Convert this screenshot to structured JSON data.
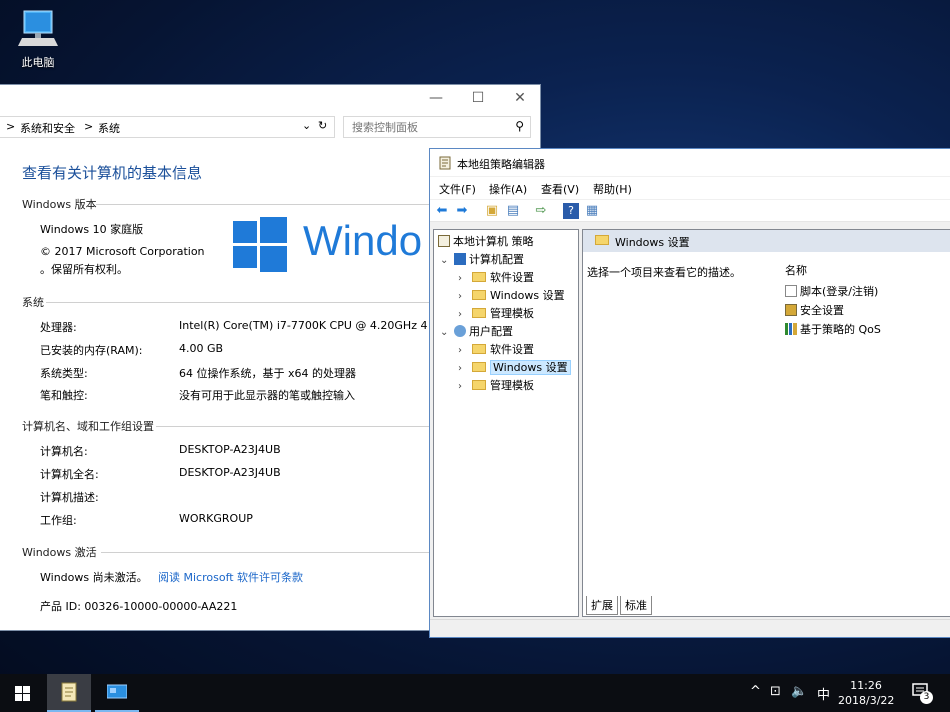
{
  "desktop": {
    "icon_label": "此电脑"
  },
  "system_window": {
    "breadcrumb": [
      ">",
      "系统和安全",
      ">",
      "系统"
    ],
    "search_placeholder": "搜索控制面板",
    "page_title": "查看有关计算机的基本信息",
    "edition_section": {
      "heading": "Windows 版本",
      "edition": "Windows 10 家庭版",
      "copyright_line1": "© 2017 Microsoft Corporation",
      "copyright_line2": "。保留所有权利。",
      "logo_text": "Windo"
    },
    "system_section": {
      "heading": "系统",
      "rows": [
        {
          "key": "处理器:",
          "value": "Intel(R) Core(TM) i7-7700K CPU @ 4.20GHz   4"
        },
        {
          "key": "已安装的内存(RAM):",
          "value": "4.00 GB"
        },
        {
          "key": "系统类型:",
          "value": "64 位操作系统，基于 x64 的处理器"
        },
        {
          "key": "笔和触控:",
          "value": "没有可用于此显示器的笔或触控输入"
        }
      ]
    },
    "computer_section": {
      "heading": "计算机名、域和工作组设置",
      "rows": [
        {
          "key": "计算机名:",
          "value": "DESKTOP-A23J4UB"
        },
        {
          "key": "计算机全名:",
          "value": "DESKTOP-A23J4UB"
        },
        {
          "key": "计算机描述:",
          "value": ""
        },
        {
          "key": "工作组:",
          "value": "WORKGROUP"
        }
      ]
    },
    "activation_section": {
      "heading": "Windows 激活",
      "status": "Windows 尚未激活。",
      "link": "阅读 Microsoft 软件许可条款",
      "product_id": "产品 ID: 00326-10000-00000-AA221"
    },
    "caption": {
      "minimize": "—",
      "maximize": "☐",
      "close": "✕"
    }
  },
  "gpedit_window": {
    "title": "本地组策略编辑器",
    "menu": [
      "文件(F)",
      "操作(A)",
      "查看(V)",
      "帮助(H)"
    ],
    "tree": {
      "root": "本地计算机 策略",
      "computer_config": "计算机配置",
      "user_config": "用户配置",
      "children": [
        "软件设置",
        "Windows 设置",
        "管理模板"
      ]
    },
    "right_pane": {
      "header": "Windows 设置",
      "description": "选择一个项目来查看它的描述。",
      "column_name": "名称",
      "items": [
        "脚本(登录/注销)",
        "安全设置",
        "基于策略的 QoS"
      ]
    },
    "tabs": [
      "扩展",
      "标准"
    ]
  },
  "taskbar": {
    "time": "11:26",
    "date": "2018/3/22",
    "ime": "中",
    "notification_count": "3"
  },
  "colors": {
    "accent": "#1f7ad8",
    "link": "#1a66c9",
    "selection": "#cce8ff",
    "desktop_bg": "#0b2250"
  }
}
